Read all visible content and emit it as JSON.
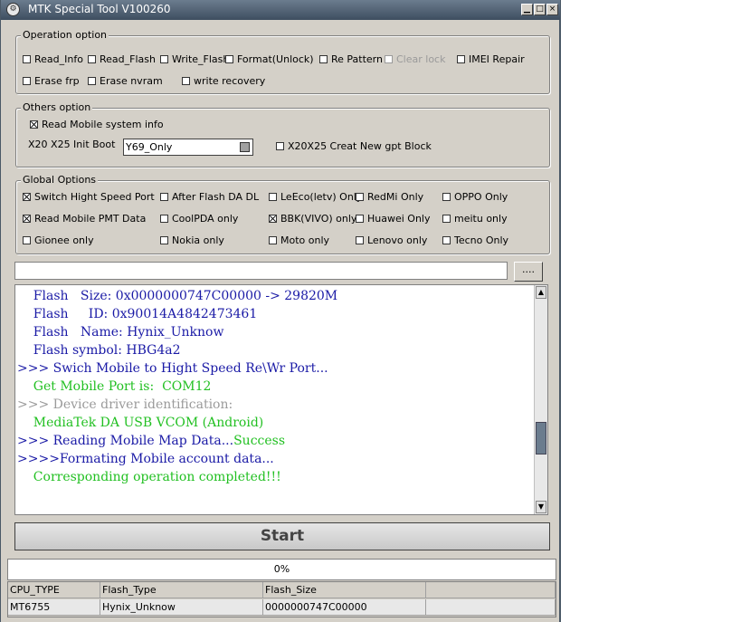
{
  "window": {
    "title": "MTK Special Tool V100260",
    "controls": [
      "minimize",
      "maximize",
      "close"
    ]
  },
  "operation_option": {
    "title": "Operation option",
    "items": [
      {
        "label": "Read_Info",
        "checked": false,
        "enabled": true
      },
      {
        "label": "Read_Flash",
        "checked": false,
        "enabled": true
      },
      {
        "label": "Write_Flash",
        "checked": false,
        "enabled": true
      },
      {
        "label": "Format(Unlock)",
        "checked": false,
        "enabled": true
      },
      {
        "label": "Re Pattern l",
        "checked": false,
        "enabled": true
      },
      {
        "label": "Clear lock",
        "checked": false,
        "enabled": false
      },
      {
        "label": "IMEI Repair",
        "checked": false,
        "enabled": true
      },
      {
        "label": "Erase frp",
        "checked": false,
        "enabled": true
      },
      {
        "label": "Erase nvram",
        "checked": false,
        "enabled": true
      },
      {
        "label": "write recovery",
        "checked": false,
        "enabled": true
      }
    ]
  },
  "others_option": {
    "title": "Others option",
    "read_mobile_system_info": {
      "label": "Read Mobile system info",
      "checked": true
    },
    "init_boot_label": "X20 X25 Init Boot",
    "init_boot_value": "Y69_Only",
    "creat_gpt": {
      "label": "X20X25 Creat New gpt Block",
      "checked": false
    }
  },
  "global_options": {
    "title": "Global Options",
    "items": [
      {
        "label": "Switch Hight Speed Port",
        "checked": true
      },
      {
        "label": "After Flash DA DL",
        "checked": false
      },
      {
        "label": "LeEco(letv) Only",
        "checked": false
      },
      {
        "label": "RedMi Only",
        "checked": false
      },
      {
        "label": "OPPO Only",
        "checked": false
      },
      {
        "label": "Read Mobile PMT Data",
        "checked": true
      },
      {
        "label": "CoolPDA only",
        "checked": false
      },
      {
        "label": "BBK(VIVO) only",
        "checked": true
      },
      {
        "label": "Huawei Only",
        "checked": false
      },
      {
        "label": "meitu only",
        "checked": false
      },
      {
        "label": "Gionee only",
        "checked": false
      },
      {
        "label": "Nokia only",
        "checked": false
      },
      {
        "label": "Moto only",
        "checked": false
      },
      {
        "label": "Lenovo only",
        "checked": false
      },
      {
        "label": "Tecno Only",
        "checked": false
      }
    ]
  },
  "file_path": {
    "value": "",
    "browse_label": "...."
  },
  "log": {
    "lines": [
      {
        "segments": [
          {
            "text": "    Flash   Size: 0x0000000747C00000 -> 29820M",
            "color": "blue"
          }
        ]
      },
      {
        "segments": [
          {
            "text": "    Flash     ID: 0x90014A4842473461",
            "color": "blue"
          }
        ]
      },
      {
        "segments": [
          {
            "text": "    Flash   Name: Hynix_Unknow",
            "color": "blue"
          }
        ]
      },
      {
        "segments": [
          {
            "text": "    Flash symbol: HBG4a2",
            "color": "blue"
          }
        ]
      },
      {
        "segments": [
          {
            "text": ">>> Swich Mobile to Hight Speed Re\\Wr Port...",
            "color": "blue"
          }
        ]
      },
      {
        "segments": [
          {
            "text": "    Get Mobile Port is:  COM12",
            "color": "green"
          }
        ]
      },
      {
        "segments": [
          {
            "text": ">>> Device driver identification:",
            "color": "gray"
          }
        ]
      },
      {
        "segments": [
          {
            "text": "    MediaTek DA USB VCOM (Android)",
            "color": "green"
          }
        ]
      },
      {
        "segments": [
          {
            "text": ">>> Reading Mobile Map Data...",
            "color": "blue"
          },
          {
            "text": "Success",
            "color": "green"
          }
        ]
      },
      {
        "segments": [
          {
            "text": ">>>>Formating Mobile account data...",
            "color": "blue"
          }
        ]
      },
      {
        "segments": [
          {
            "text": "    Corresponding operation completed!!!",
            "color": "green"
          }
        ]
      }
    ]
  },
  "start_button": {
    "label": "Start"
  },
  "progress": {
    "text": "0%",
    "value": 0
  },
  "info_table": {
    "headers": [
      "CPU_TYPE",
      "Flash_Type",
      "Flash_Size",
      ""
    ],
    "rows": [
      [
        "MT6755",
        "Hynix_Unknow",
        "0000000747C00000",
        ""
      ]
    ]
  },
  "colors": {
    "blue": "#1a1aa6",
    "green": "#22c022",
    "gray": "#9a9a9a",
    "titlebar": "#4f6072"
  }
}
